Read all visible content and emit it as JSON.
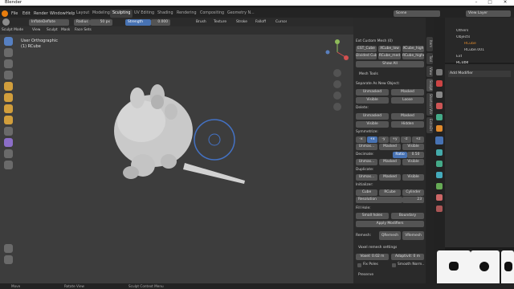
{
  "app": {
    "title": "Blender"
  },
  "menu": [
    "File",
    "Edit",
    "Render",
    "Window",
    "Help"
  ],
  "workspaces": [
    "Layout",
    "Modeling",
    "Sculpting",
    "UV Editing",
    "Shading",
    "Rendering",
    "Compositing",
    "Geometry N..."
  ],
  "scene": {
    "label": "Scene",
    "view_layer": "View Layer"
  },
  "tool_header": {
    "brush": "InflateDeflate",
    "radius_label": "Radius",
    "radius_value": "50 px",
    "strength_label": "Strength",
    "strength_value": "0.000",
    "brush_menu": "Brush",
    "texture_menu": "Texture",
    "stroke_menu": "Stroke",
    "falloff_menu": "Falloff",
    "cursor_menu": "Cursor",
    "dyntopo": "Dyntopo",
    "remesh": "Remesh",
    "options": "Options"
  },
  "header2": [
    "Sculpt Mode",
    "View",
    "Sculpt",
    "Mask",
    "Face Sets"
  ],
  "viewport": {
    "view_name": "User Orthographic",
    "object_name": "(1) RCube"
  },
  "npanel": {
    "ext_label": "Ext Custom Mesh (0)",
    "row1": [
      "EST_Cube",
      "XCube_low",
      "XCube_high"
    ],
    "row2": [
      "Divided Cube",
      "RCube_med",
      "RCube_higher"
    ],
    "show_all": "Show All",
    "section": "Mesh Tools",
    "separate_label": "Separate As New Object:",
    "separate_btns": [
      "Unmasked",
      "Masked",
      "Visible",
      "Loose"
    ],
    "delete_label": "Delete:",
    "delete_btns": [
      "Unmasked",
      "Masked",
      "Visible",
      "Hidden"
    ],
    "symmetrize_label": "Symmetrize:",
    "sym_axes": [
      "-x",
      "+x",
      "-y",
      "+y",
      "-z",
      "+z"
    ],
    "sym_btns": [
      "Unmas...",
      "Masked",
      "Visible"
    ],
    "decimate_label": "Decimate:",
    "decimate_field": "Ratio",
    "decimate_value": "0.50",
    "decimate_btns": [
      "Unmas...",
      "Masked",
      "Visible"
    ],
    "duplicate_label": "Duplicate:",
    "duplicate_btns": [
      "Unmas...",
      "Masked",
      "Visible"
    ],
    "initializer_label": "Initializer:",
    "init_btns": [
      "Cube",
      "RCube",
      "Cylinder"
    ],
    "resolution_label": "Resolution",
    "resolution_value": "23",
    "fill_label": "Fill Hole:",
    "fill_btns": [
      "Small holes",
      "Boundary"
    ],
    "apply_modifiers": "Apply Modifiers",
    "remesh_label": "Remesh:",
    "remesh_btns": [
      "QRemesh",
      "VRemesh"
    ],
    "voxel_label": "Voxel remesh settings",
    "voxel_value": "Voxel: 0.02 m",
    "adaptivity": "Adaptivit: 0 m",
    "fix_poles": "Fix Poles",
    "smooth_normals": "Smooth Norm...",
    "preserve": "Preserve"
  },
  "sidetabs": [
    "Item",
    "Tool",
    "View",
    "Sculpt",
    "Shortcut VUr",
    "ExtraDr"
  ],
  "outliner": {
    "items": [
      "Others",
      "Objects",
      "RCube",
      "RCube.001",
      "Ext"
    ]
  },
  "properties": {
    "object_name": "RCube",
    "add_modifier": "Add Modifier"
  },
  "status": [
    "Move",
    "Rotate View",
    "Sculpt Context Menu"
  ],
  "colors": {
    "accent": "#4772b3",
    "active_object": "#e08a2c"
  }
}
